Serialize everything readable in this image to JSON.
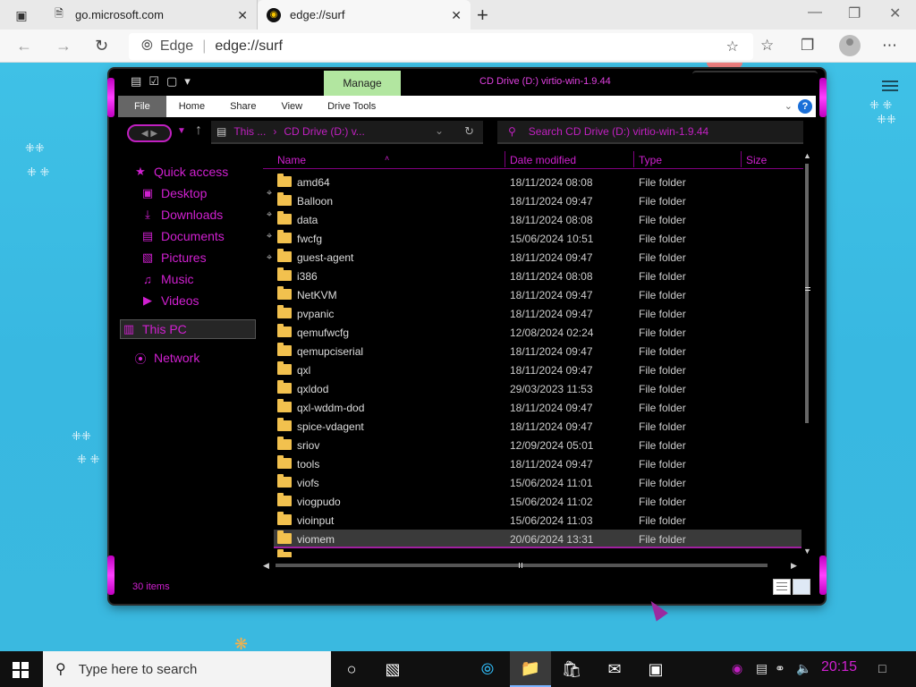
{
  "browser": {
    "tabs": [
      {
        "title": "go.microsoft.com",
        "favicon": "document-icon"
      },
      {
        "title": "edge://surf",
        "favicon": "surf-game-icon",
        "active": true
      }
    ],
    "address": {
      "brand": "Edge",
      "url": "edge://surf"
    }
  },
  "explorer": {
    "title": "CD Drive (D:) virtio-win-1.9.44",
    "contextual_tab": "Manage",
    "ribbon_tabs": [
      "File",
      "Home",
      "Share",
      "View",
      "Drive Tools"
    ],
    "breadcrumb": [
      "This ...",
      "CD Drive (D:) v..."
    ],
    "search_placeholder": "Search CD Drive (D:) virtio-win-1.9.44",
    "columns": [
      "Name",
      "Date modified",
      "Type",
      "Size"
    ],
    "sidebar": [
      {
        "label": "Quick access",
        "icon": "star-icon",
        "pinned": false
      },
      {
        "label": "Desktop",
        "icon": "desktop-icon",
        "pinned": true
      },
      {
        "label": "Downloads",
        "icon": "download-icon",
        "pinned": true
      },
      {
        "label": "Documents",
        "icon": "documents-icon",
        "pinned": true
      },
      {
        "label": "Pictures",
        "icon": "pictures-icon",
        "pinned": true
      },
      {
        "label": "Music",
        "icon": "music-icon",
        "pinned": false
      },
      {
        "label": "Videos",
        "icon": "videos-icon",
        "pinned": false
      },
      {
        "label": "This PC",
        "icon": "computer-icon",
        "pinned": false,
        "selected": true
      },
      {
        "label": "Network",
        "icon": "network-icon",
        "pinned": false
      }
    ],
    "files": [
      {
        "name": "amd64",
        "date": "18/11/2024 08:08",
        "type": "File folder"
      },
      {
        "name": "Balloon",
        "date": "18/11/2024 09:47",
        "type": "File folder"
      },
      {
        "name": "data",
        "date": "18/11/2024 08:08",
        "type": "File folder"
      },
      {
        "name": "fwcfg",
        "date": "15/06/2024 10:51",
        "type": "File folder"
      },
      {
        "name": "guest-agent",
        "date": "18/11/2024 09:47",
        "type": "File folder"
      },
      {
        "name": "i386",
        "date": "18/11/2024 08:08",
        "type": "File folder"
      },
      {
        "name": "NetKVM",
        "date": "18/11/2024 09:47",
        "type": "File folder"
      },
      {
        "name": "pvpanic",
        "date": "18/11/2024 09:47",
        "type": "File folder"
      },
      {
        "name": "qemufwcfg",
        "date": "12/08/2024 02:24",
        "type": "File folder"
      },
      {
        "name": "qemupciserial",
        "date": "18/11/2024 09:47",
        "type": "File folder"
      },
      {
        "name": "qxl",
        "date": "18/11/2024 09:47",
        "type": "File folder"
      },
      {
        "name": "qxldod",
        "date": "29/03/2023 11:53",
        "type": "File folder"
      },
      {
        "name": "qxl-wddm-dod",
        "date": "18/11/2024 09:47",
        "type": "File folder"
      },
      {
        "name": "spice-vdagent",
        "date": "18/11/2024 09:47",
        "type": "File folder"
      },
      {
        "name": "sriov",
        "date": "12/09/2024 05:01",
        "type": "File folder"
      },
      {
        "name": "tools",
        "date": "18/11/2024 09:47",
        "type": "File folder"
      },
      {
        "name": "viofs",
        "date": "15/06/2024 11:01",
        "type": "File folder"
      },
      {
        "name": "viogpudo",
        "date": "15/06/2024 11:02",
        "type": "File folder"
      },
      {
        "name": "vioinput",
        "date": "15/06/2024 11:03",
        "type": "File folder"
      },
      {
        "name": "viomem",
        "date": "20/06/2024 13:31",
        "type": "File folder",
        "selected": true
      }
    ],
    "status": "30 items"
  },
  "taskbar": {
    "search_placeholder": "Type here to search",
    "clock": "20:15",
    "pinned": [
      "task-view-icon",
      "edge-icon",
      "file-explorer-icon",
      "store-icon",
      "mail-icon",
      "app-icon"
    ]
  },
  "colors": {
    "accent": "#d020d0",
    "water": "#3fc1e6",
    "manage_tab": "#b2e6a0"
  }
}
